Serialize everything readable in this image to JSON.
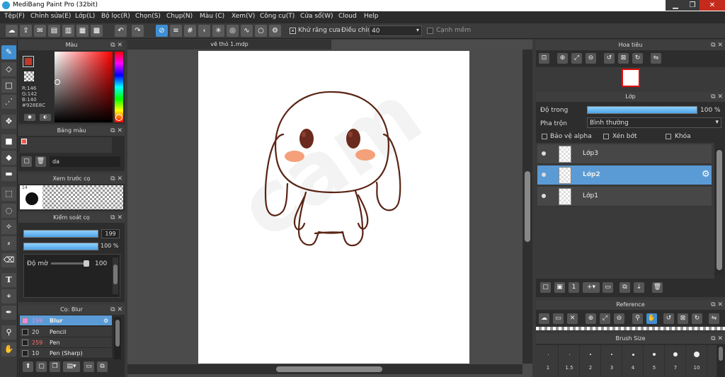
{
  "window": {
    "title": "MediBang Paint Pro (32bit)",
    "minimize": "▁",
    "maximize": "❐",
    "close": "✕"
  },
  "menu": [
    "Tệp(F)",
    "Chỉnh sửa(E)",
    "Lớp(L)",
    "Bộ lọc(R)",
    "Chọn(S)",
    "Chụp(N)",
    "Màu (C)",
    "Xem(V)",
    "Công cụ(T)",
    "Cửa sổ(W)",
    "Cloud",
    "Help"
  ],
  "toolbar": {
    "antialias_label": "Khử răng cưa",
    "adjust_label": "Điều chỉnh",
    "adjust_value": "40",
    "smooth_label": "Cạnh mềm"
  },
  "color_panel": {
    "title": "Màu",
    "r": "R:146",
    "g": "G:142",
    "b": "B:140",
    "hex": "#928E8C",
    "fg_color": "#c0392b"
  },
  "swatch_panel": {
    "title": "Bảng màu",
    "name": "da"
  },
  "brush_preview": {
    "title": "Xem trước cọ",
    "size": "14"
  },
  "brush_control": {
    "title": "Kiểm soát cọ",
    "size_value": "199",
    "opacity_value": "100 %",
    "blur_label": "Độ mờ",
    "blur_value": "100"
  },
  "brush_panel": {
    "title": "Cọ: Blur",
    "items": [
      {
        "size": "199",
        "name": "Blur",
        "color": "#e88cd8"
      },
      {
        "size": "20",
        "name": "Pencil",
        "color": "#222222"
      },
      {
        "size": "259",
        "name": "Pen",
        "color": "#222222"
      },
      {
        "size": "10",
        "name": "Pen (Sharp)",
        "color": "#222222"
      }
    ]
  },
  "canvas": {
    "tab": "vẽ thỏ 1.mdp",
    "watermark": "cam"
  },
  "navigator": {
    "title": "Hoa tiêu"
  },
  "layers": {
    "title": "Lớp",
    "opacity_label": "Độ trong",
    "opacity_value": "100 %",
    "blend_label": "Pha trộn",
    "blend_value": "Bình thường",
    "protect_alpha": "Bảo vệ alpha",
    "clipping": "Xén bớt",
    "lock": "Khóa",
    "items": [
      {
        "name": "Lớp3"
      },
      {
        "name": "Lớp2"
      },
      {
        "name": "Lớp1"
      }
    ]
  },
  "reference": {
    "title": "Reference"
  },
  "brush_size": {
    "title": "Brush Size",
    "sizes": [
      "1",
      "1.5",
      "2",
      "3",
      "4",
      "5",
      "7",
      "10"
    ]
  },
  "colors": {
    "accent": "#3f8fd2",
    "selected_layer": "#5b9bd5",
    "line_art": "#5a2414",
    "blush": "#f4a07a",
    "eye": "#6b2a1e"
  }
}
